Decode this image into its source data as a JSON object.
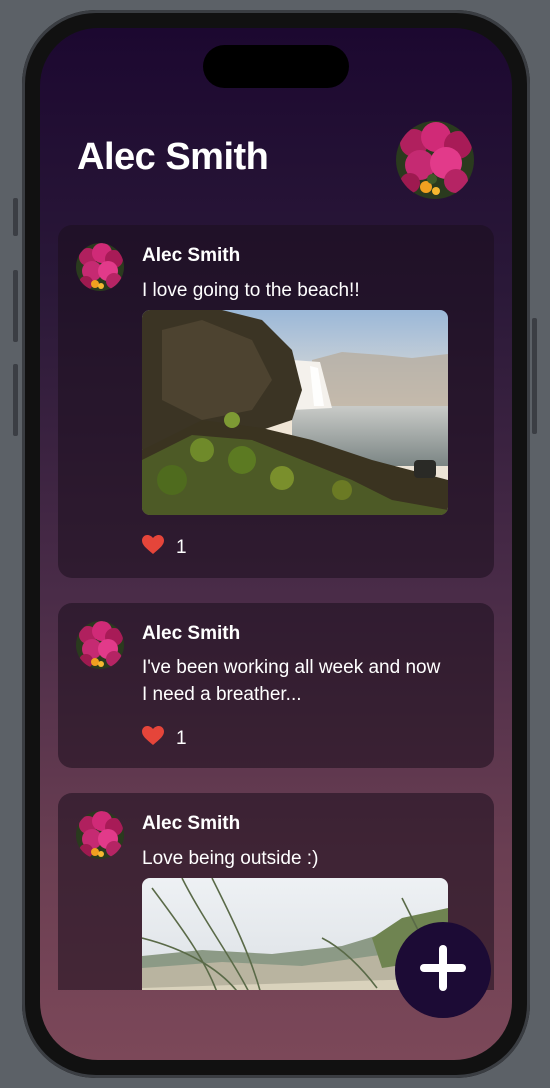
{
  "header": {
    "title": "Alec Smith"
  },
  "posts": [
    {
      "author": "Alec Smith",
      "text": "I love going to the beach!!",
      "likes": "1",
      "image": "waterfall-photo"
    },
    {
      "author": "Alec Smith",
      "text": "I've been working all week and now I need a breather...",
      "likes": "1"
    },
    {
      "author": "Alec Smith",
      "text": "Love being outside :)",
      "image": "dunes-photo"
    }
  ],
  "icons": {
    "like": "heart-icon",
    "add": "plus-icon"
  },
  "colors": {
    "heart": "#e5453a",
    "fab": "#1c0b35"
  }
}
